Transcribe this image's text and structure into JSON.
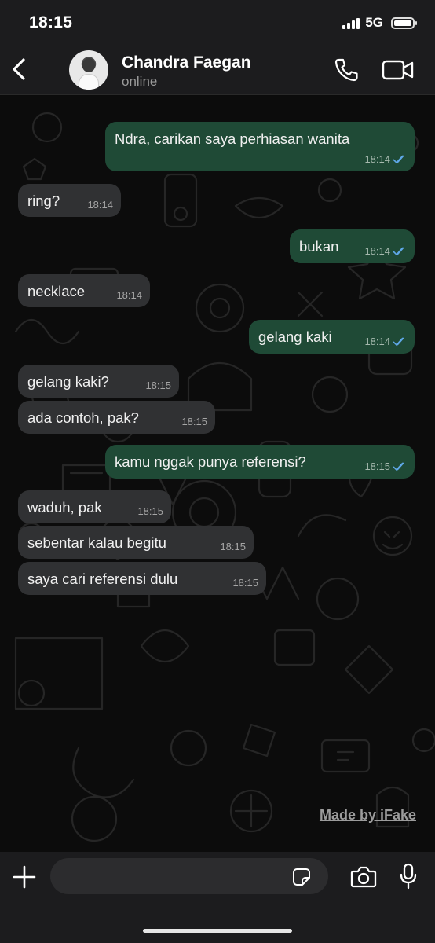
{
  "status_bar": {
    "time": "18:15",
    "network": "5G"
  },
  "header": {
    "contact_name": "Chandra Faegan",
    "contact_status": "online"
  },
  "messages": [
    {
      "direction": "out",
      "text": "Ndra, carikan saya perhiasan wanita",
      "time": "18:14",
      "read": true
    },
    {
      "direction": "in",
      "text": "ring?",
      "time": "18:14"
    },
    {
      "direction": "out",
      "text": "bukan",
      "time": "18:14",
      "read": true
    },
    {
      "direction": "in",
      "text": "necklace",
      "time": "18:14"
    },
    {
      "direction": "out",
      "text": "gelang kaki",
      "time": "18:14",
      "read": true
    },
    {
      "direction": "in",
      "text": "gelang kaki?",
      "time": "18:15"
    },
    {
      "direction": "in",
      "text": "ada contoh, pak?",
      "time": "18:15"
    },
    {
      "direction": "out",
      "text": "kamu nggak punya referensi?",
      "time": "18:15",
      "read": true
    },
    {
      "direction": "in",
      "text": "waduh, pak",
      "time": "18:15"
    },
    {
      "direction": "in",
      "text": "sebentar kalau begitu",
      "time": "18:15"
    },
    {
      "direction": "in",
      "text": "saya cari referensi dulu",
      "time": "18:15"
    }
  ],
  "watermark": "Made by iFake",
  "input": {
    "placeholder": "",
    "value": ""
  },
  "icons": {
    "back": "chevron-left-icon",
    "call": "phone-icon",
    "video": "video-camera-icon",
    "plus": "plus-icon",
    "sticker": "sticker-icon",
    "camera": "camera-icon",
    "mic": "microphone-icon",
    "read_receipt": "double-check-icon"
  },
  "colors": {
    "outgoing_bubble": "#1f4a36",
    "incoming_bubble": "#303133",
    "read_tick": "#5fa8e8",
    "background": "#0c0c0c",
    "bar": "#1c1c1e"
  }
}
